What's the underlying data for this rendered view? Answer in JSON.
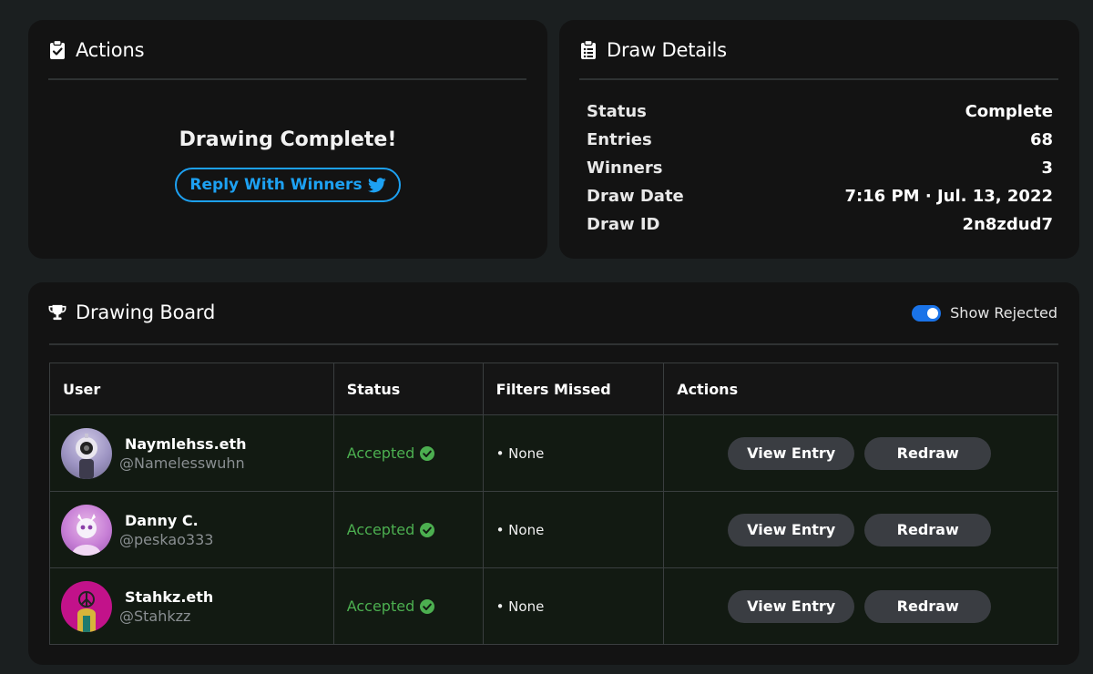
{
  "actions": {
    "title": "Actions",
    "completion_text": "Drawing Complete!",
    "reply_button_label": "Reply With Winners",
    "icon": "clipboard-check-icon"
  },
  "details": {
    "title": "Draw Details",
    "icon": "clipboard-list-icon",
    "rows": [
      {
        "label": "Status",
        "value": "Complete"
      },
      {
        "label": "Entries",
        "value": "68"
      },
      {
        "label": "Winners",
        "value": "3"
      },
      {
        "label": "Draw Date",
        "value": "7:16 PM · Jul. 13, 2022"
      },
      {
        "label": "Draw ID",
        "value": "2n8zdud7"
      }
    ]
  },
  "board": {
    "title": "Drawing Board",
    "icon": "trophy-icon",
    "show_rejected_label": "Show Rejected",
    "show_rejected_on": true,
    "columns": [
      "User",
      "Status",
      "Filters Missed",
      "Actions"
    ],
    "rows": [
      {
        "name": "Naymlehss.eth",
        "handle": "@Namelesswuhn",
        "status": "Accepted",
        "filters": "• None",
        "view_label": "View Entry",
        "redraw_label": "Redraw"
      },
      {
        "name": "Danny C.",
        "handle": "@peskao333",
        "status": "Accepted",
        "filters": "• None",
        "view_label": "View Entry",
        "redraw_label": "Redraw"
      },
      {
        "name": "Stahkz.eth",
        "handle": "@Stahkzz",
        "status": "Accepted",
        "filters": "• None",
        "view_label": "View Entry",
        "redraw_label": "Redraw"
      }
    ]
  },
  "colors": {
    "background": "#1b1f20",
    "card": "#131313",
    "accent_blue": "#1da1f2",
    "toggle_blue": "#1a73e8",
    "accepted_green": "#4caf50",
    "row_background": "#121a12",
    "button_gray": "#3a3d42"
  }
}
